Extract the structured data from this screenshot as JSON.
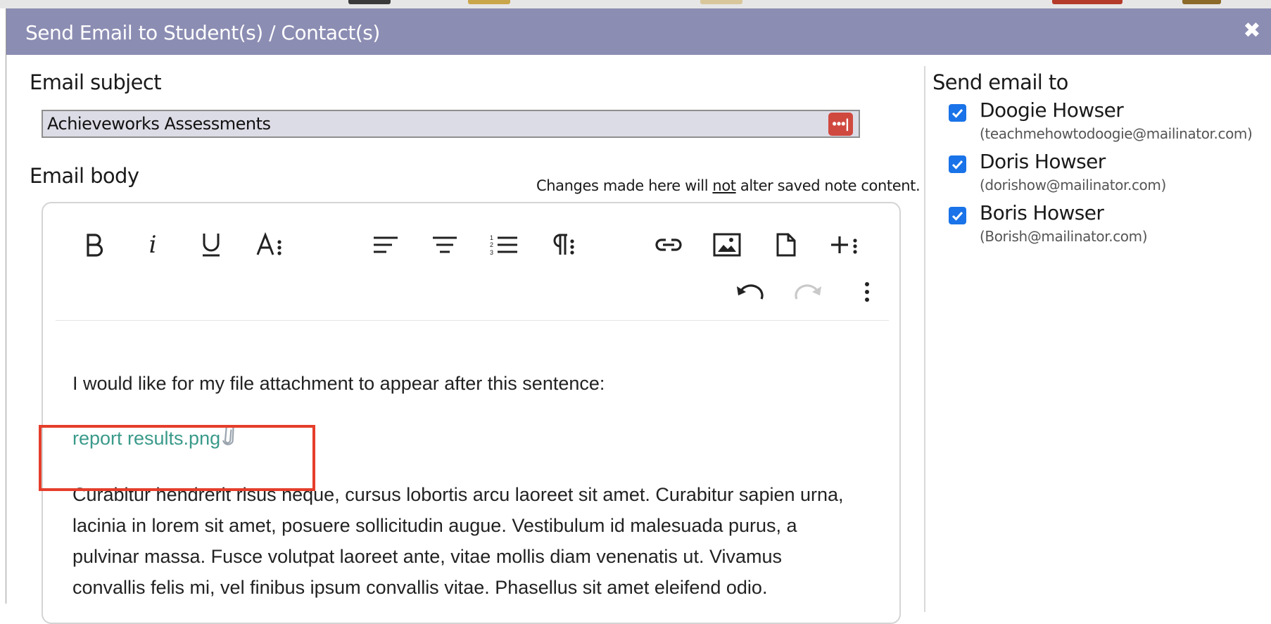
{
  "dialog": {
    "title": "Send Email to Student(s) / Contact(s)",
    "close_icon": "close-icon",
    "header_color": "#8c8db3"
  },
  "subject": {
    "label": "Email subject",
    "value": "Achieveworks Assessments",
    "password_manager_icon": "password-manager-icon"
  },
  "body": {
    "label": "Email body",
    "note_before": "Changes made here will ",
    "note_emph": "not",
    "note_after": " alter saved note content."
  },
  "toolbar": {
    "row1": [
      "bold-icon",
      "italic-icon",
      "underline-icon",
      "text-style-icon",
      "align-left-icon",
      "align-center-icon",
      "ordered-list-icon",
      "paragraph-format-icon",
      "link-icon",
      "image-icon",
      "file-icon",
      "more-insert-icon"
    ],
    "row2": [
      "undo-icon",
      "redo-icon",
      "more-options-icon"
    ]
  },
  "editor_content": {
    "line1": "I would like for my file attachment to appear after this sentence:",
    "attachment": "report results.png",
    "attachment_color": "#3a9a8a",
    "paragraph_lines": [
      "Curabitur hendrerit risus neque, cursus lobortis arcu laoreet sit amet. Curabitur sapien urna,",
      "lacinia in lorem sit amet, posuere sollicitudin augue. Vestibulum id malesuada purus, a",
      "pulvinar massa. Fusce volutpat laoreet ante, vitae mollis diam venenatis ut. Vivamus",
      "convallis felis mi, vel finibus ipsum convallis vitae. Phasellus sit amet eleifend odio."
    ]
  },
  "recipients": {
    "label": "Send email to",
    "items": [
      {
        "name": "Doogie Howser",
        "email": "(teachmehowtodoogie@mailinator.com)",
        "checked": true
      },
      {
        "name": "Doris Howser",
        "email": "(dorishow@mailinator.com)",
        "checked": true
      },
      {
        "name": "Boris Howser",
        "email": "(Borish@mailinator.com)",
        "checked": true
      }
    ],
    "checkbox_color": "#1a73e8"
  },
  "annotation_color": "#e53e2b"
}
